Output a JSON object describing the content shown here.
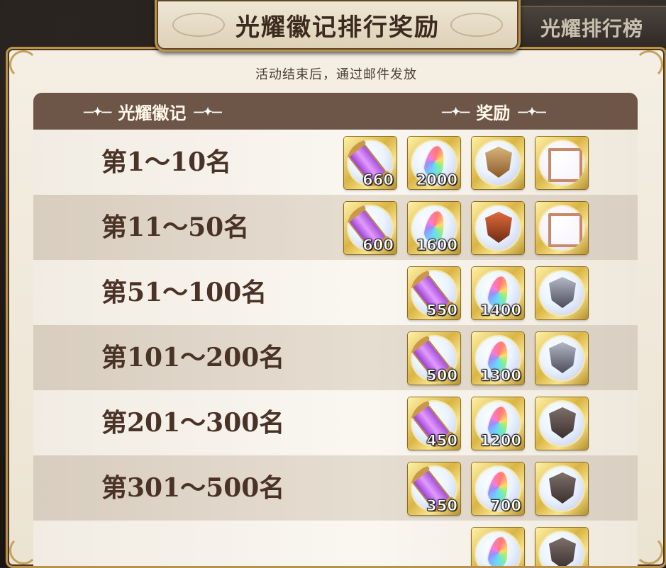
{
  "title": "光耀徽记排行奖励",
  "side_tab": "光耀排行榜",
  "subtitle": "活动结束后，通过邮件发放",
  "headers": {
    "badge": "光耀徽记",
    "reward": "奖励"
  },
  "rows": [
    {
      "rank": "第1～10名",
      "rewards": [
        {
          "icon": "purple-scroll-icon",
          "qty": "660"
        },
        {
          "icon": "rainbow-crystal-icon",
          "qty": "2000"
        },
        {
          "icon": "gold-emblem-icon",
          "qty": ""
        },
        {
          "icon": "avatar-frame-icon",
          "qty": ""
        }
      ]
    },
    {
      "rank": "第11～50名",
      "rewards": [
        {
          "icon": "purple-scroll-icon",
          "qty": "600"
        },
        {
          "icon": "rainbow-crystal-icon",
          "qty": "1600"
        },
        {
          "icon": "red-emblem-icon",
          "qty": ""
        },
        {
          "icon": "avatar-frame-icon",
          "qty": ""
        }
      ]
    },
    {
      "rank": "第51～100名",
      "rewards": [
        {
          "icon": "purple-scroll-icon",
          "qty": "550"
        },
        {
          "icon": "rainbow-crystal-icon",
          "qty": "1400"
        },
        {
          "icon": "steel-emblem-icon",
          "qty": ""
        }
      ]
    },
    {
      "rank": "第101～200名",
      "rewards": [
        {
          "icon": "purple-scroll-icon",
          "qty": "500"
        },
        {
          "icon": "rainbow-crystal-icon",
          "qty": "1300"
        },
        {
          "icon": "steel-emblem-icon",
          "qty": ""
        }
      ]
    },
    {
      "rank": "第201～300名",
      "rewards": [
        {
          "icon": "purple-scroll-icon",
          "qty": "450"
        },
        {
          "icon": "rainbow-crystal-icon",
          "qty": "1200"
        },
        {
          "icon": "dark-emblem-icon",
          "qty": ""
        }
      ]
    },
    {
      "rank": "第301～500名",
      "rewards": [
        {
          "icon": "purple-scroll-icon",
          "qty": "350"
        },
        {
          "icon": "rainbow-crystal-icon",
          "qty": "700"
        },
        {
          "icon": "dark-emblem-icon",
          "qty": ""
        }
      ]
    },
    {
      "rank": "",
      "rewards": [
        {
          "icon": "rainbow-crystal-icon",
          "qty": ""
        },
        {
          "icon": "dark-emblem-icon",
          "qty": ""
        }
      ]
    }
  ]
}
